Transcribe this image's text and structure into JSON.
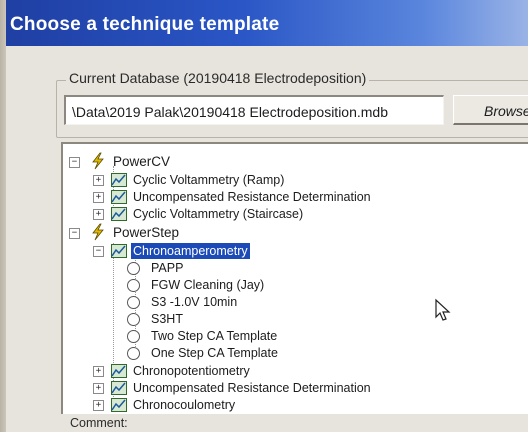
{
  "window": {
    "title": "Choose a technique template"
  },
  "database": {
    "group_label": "Current Database (20190418 Electrodeposition)",
    "path": "\\Data\\2019 Palak\\20190418 Electrodeposition.mdb",
    "browse_label": "Browse..."
  },
  "tree": {
    "groups": [
      {
        "label": "PowerCV",
        "icon": "bolt-icon",
        "items": [
          {
            "label": "Cyclic Voltammetry (Ramp)",
            "icon": "chart-icon"
          },
          {
            "label": "Uncompensated Resistance Determination",
            "icon": "chart-icon"
          },
          {
            "label": "Cyclic Voltammetry (Staircase)",
            "icon": "chart-icon"
          }
        ]
      },
      {
        "label": "PowerStep",
        "icon": "bolt-icon",
        "items": [
          {
            "label": "Chronoamperometry",
            "icon": "chart-icon",
            "selected": true,
            "templates": [
              {
                "label": "PAPP"
              },
              {
                "label": "FGW Cleaning (Jay)"
              },
              {
                "label": "S3 -1.0V 10min"
              },
              {
                "label": "S3HT"
              },
              {
                "label": "Two Step CA Template"
              },
              {
                "label": "One Step CA Template"
              }
            ]
          },
          {
            "label": "Chronopotentiometry",
            "icon": "chart-icon"
          },
          {
            "label": "Uncompensated Resistance Determination",
            "icon": "chart-icon"
          },
          {
            "label": "Chronocoulometry",
            "icon": "chart-icon"
          }
        ]
      }
    ]
  },
  "comment": {
    "label": "Comment:"
  },
  "colors": {
    "titlebar": "#2a56c6",
    "selection": "#1c4bb8"
  }
}
